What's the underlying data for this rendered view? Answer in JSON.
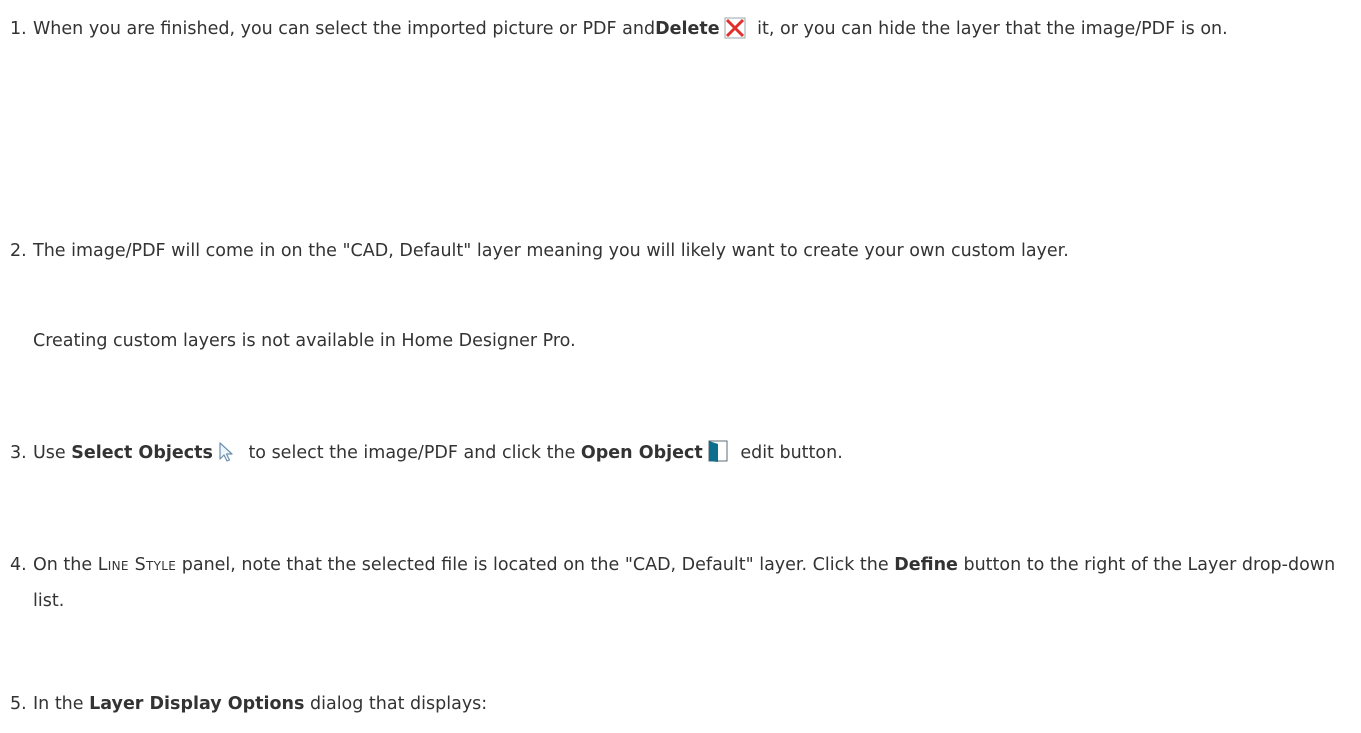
{
  "steps": [
    {
      "number": "1.",
      "t1": "When you are finished, you can select the imported picture or PDF and",
      "b1": "Delete",
      "t2": " it, or you can hide the layer that the image/PDF is on.",
      "icon": "delete-icon"
    },
    {
      "number": "2.",
      "t1": "The image/PDF will come in on the \"CAD, Default\" layer meaning you will likely want to create your own custom layer.",
      "note": "Creating custom layers is not available in Home Designer Pro."
    },
    {
      "number": "3.",
      "t1": "Use ",
      "b1": "Select Objects",
      "t2": " to select the image/PDF and click the ",
      "b2": "Open Object",
      "t3": " edit button.",
      "icon1": "select-objects-arrow-icon",
      "icon2": "open-object-icon"
    },
    {
      "number": "4.",
      "t1": "On the ",
      "sc": "Line Style",
      "t2": " panel, note that the selected file is located on the \"CAD, Default\" layer. Click the ",
      "b1": "Define",
      "t3": " button to the right of the Layer drop-down list."
    },
    {
      "number": "5.",
      "t1": "In the ",
      "b1": "Layer Display Options",
      "t2": " dialog that displays:"
    }
  ],
  "colors": {
    "text": "#333333",
    "delete_icon": "#e0302c",
    "open_object_icon": "#0e6e8e"
  }
}
